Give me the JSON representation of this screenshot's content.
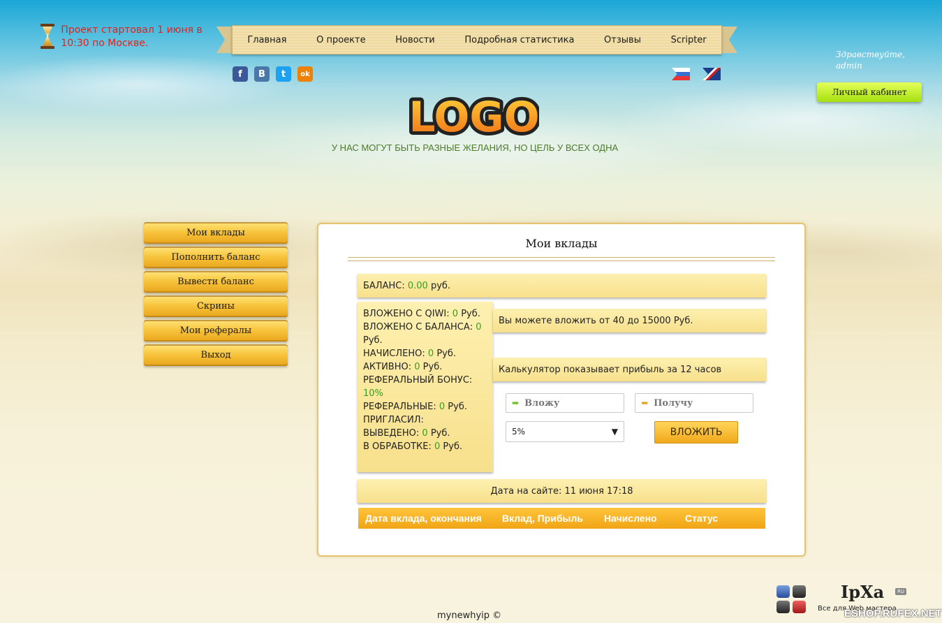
{
  "notice": {
    "text": "Проект стартовал 1 июня в 10:30 по Москве."
  },
  "nav": {
    "items": [
      "Главная",
      "О проекте",
      "Новости",
      "Подробная статистика",
      "Отзывы",
      "Scripter"
    ]
  },
  "socials": [
    {
      "name": "facebook",
      "glyph": "f",
      "color": "#3b5998"
    },
    {
      "name": "vkontakte",
      "glyph": "В",
      "color": "#4a76a8"
    },
    {
      "name": "twitter",
      "glyph": "t",
      "color": "#1da1f2"
    },
    {
      "name": "odnoklassniki",
      "glyph": "ok",
      "color": "#ee8208"
    }
  ],
  "greeting": {
    "line1": "Здравствуйте,",
    "line2": "admin"
  },
  "cabinet_label": "Личный кабинет",
  "logo": {
    "text": "LOGO"
  },
  "slogan": "У НАС МОГУТ БЫТЬ РАЗНЫЕ ЖЕЛАНИЯ, НО ЦЕЛЬ У ВСЕХ ОДНА",
  "sidebar": {
    "items": [
      "Мои вклады",
      "Пополнить баланс",
      "Вывести баланс",
      "Скрины",
      "Мои рефералы",
      "Выход"
    ]
  },
  "main": {
    "title": "Мои вклады",
    "balance": {
      "label": "БАЛАНС:",
      "value": "0.00",
      "unit": "руб."
    },
    "stats": {
      "qiwi_label": "ВЛОЖЕНО С QIWI:",
      "qiwi_value": "0",
      "qiwi_unit": "Руб.",
      "bal_label": "ВЛОЖЕНО С БАЛАНСА:",
      "bal_value": "0",
      "bal_unit": "Руб.",
      "accrued_label": "НАЧИСЛЕНО:",
      "accrued_value": "0",
      "accrued_unit": "Руб.",
      "active_label": "АКТИВНО:",
      "active_value": "0",
      "active_unit": "Руб.",
      "refbonus_label": "РЕФЕРАЛЬНЫЙ БОНУС:",
      "refbonus_value": "10%",
      "refs_label": "РЕФЕРАЛЬНЫЕ:",
      "refs_value": "0",
      "refs_unit": "Руб.",
      "invited_label": "ПРИГЛАСИЛ:",
      "withdrawn_label": "ВЫВЕДЕНО:",
      "withdrawn_value": "0",
      "withdrawn_unit": "Руб.",
      "pending_label": "В ОБРАБОТКЕ:",
      "pending_value": "0",
      "pending_unit": "Руб."
    },
    "invest_range": "Вы можете вложить от 40 до 15000 Руб.",
    "calc_note": "Калькулятор показывает прибыль за 12 часов",
    "give_placeholder": "Вложу",
    "take_placeholder": "Получу",
    "percent_selected": "5%",
    "invest_button": "ВЛОЖИТЬ",
    "site_date": "Дата на сайте: 11 июня 17:18",
    "table_headers": [
      "Дата вклада, окончания",
      "Вклад, Прибыль",
      "Начислено",
      "Статус"
    ]
  },
  "footer": "mynewhyip ©",
  "watermark": {
    "brand": "IpXa",
    "ru": "RU",
    "sub": "Все для Web мастера",
    "site": "ESHOP.RUFEX.NET"
  }
}
